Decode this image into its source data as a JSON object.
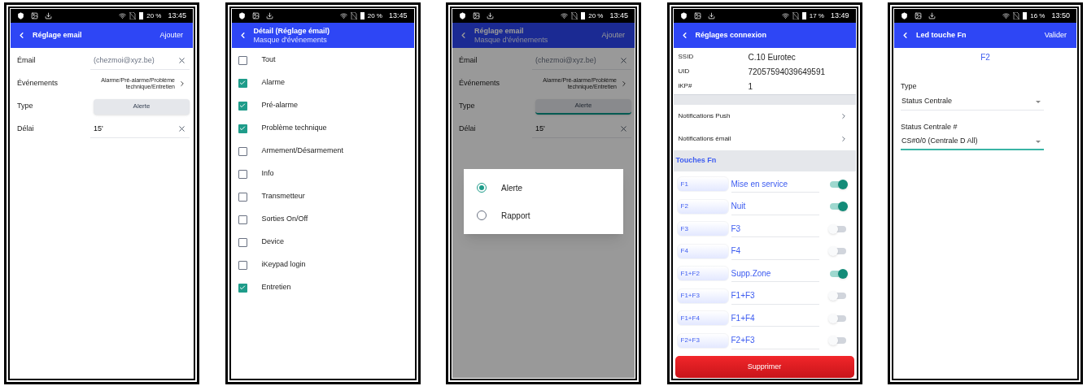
{
  "phones": [
    {
      "kind": "email_settings",
      "status_bar": {
        "battery": "20 %",
        "time": "13:45"
      },
      "header": {
        "title": "Réglage email",
        "action": "Ajouter"
      },
      "fields": [
        {
          "kind": "text",
          "label": "Émail",
          "placeholder": "(chezmoi@xyz.be)"
        },
        {
          "kind": "link",
          "label": "Événements",
          "value": "Alarme/Pré-alarme/Problème technique/Entretien"
        },
        {
          "kind": "button",
          "label": "Type",
          "value": "Alerte",
          "focused": false
        },
        {
          "kind": "text",
          "label": "Délai",
          "value": "15'"
        }
      ]
    },
    {
      "kind": "event_mask",
      "status_bar": {
        "battery": "20 %",
        "time": "13:45"
      },
      "header": {
        "title": "Détail (Réglage émail)",
        "subtitle": "Masque d'événements"
      },
      "options": [
        {
          "label": "Tout",
          "checked": false
        },
        {
          "label": "Alarme",
          "checked": true
        },
        {
          "label": "Pré-alarme",
          "checked": true
        },
        {
          "label": "Problème technique",
          "checked": true
        },
        {
          "label": "Armement/Désarmement",
          "checked": false
        },
        {
          "label": "Info",
          "checked": false
        },
        {
          "label": "Transmetteur",
          "checked": false
        },
        {
          "label": "Sorties On/Off",
          "checked": false
        },
        {
          "label": "Device",
          "checked": false
        },
        {
          "label": "iKeypad login",
          "checked": false
        },
        {
          "label": "Entretien",
          "checked": true
        }
      ]
    },
    {
      "kind": "type_dialog",
      "status_bar": {
        "battery": "20 %",
        "time": "13:45"
      },
      "header": {
        "title": "Réglage email",
        "subtitle": "Masque d'événements",
        "action": "Ajouter"
      },
      "fields": [
        {
          "kind": "text",
          "label": "Émail",
          "placeholder": "(chezmoi@xyz.be)"
        },
        {
          "kind": "link",
          "label": "Événements",
          "value": "Alarme/Pré-alarme/Problème technique/Entretien"
        },
        {
          "kind": "button",
          "label": "Type",
          "value": "Alerte",
          "focused": true
        },
        {
          "kind": "text",
          "label": "Délai",
          "value": "15'"
        }
      ],
      "dialog": {
        "options": [
          {
            "label": "Alerte",
            "selected": true
          },
          {
            "label": "Rapport",
            "selected": false
          }
        ]
      }
    },
    {
      "kind": "connection_settings",
      "status_bar": {
        "battery": "17 %",
        "time": "13:49"
      },
      "header": {
        "title": "Réglages connexion"
      },
      "info": [
        {
          "label": "SSID",
          "value": "C.10 Eurotec"
        },
        {
          "label": "UID",
          "value": "72057594039649591"
        },
        {
          "label": "iKP#",
          "value": "1"
        }
      ],
      "links": [
        "Notifications Push",
        "Notifications émail"
      ],
      "section": "Touches Fn",
      "fn_keys": [
        {
          "key": "F1",
          "label": "Mise en service",
          "on": true
        },
        {
          "key": "F2",
          "label": "Nuit",
          "on": true
        },
        {
          "key": "F3",
          "label": "F3",
          "on": false
        },
        {
          "key": "F4",
          "label": "F4",
          "on": false
        },
        {
          "key": "F1+F2",
          "label": "Supp.Zone",
          "on": true
        },
        {
          "key": "F1+F3",
          "label": "F1+F3",
          "on": false
        },
        {
          "key": "F1+F4",
          "label": "F1+F4",
          "on": false
        },
        {
          "key": "F2+F3",
          "label": "F2+F3",
          "on": false
        }
      ],
      "delete_button": "Supprimer"
    },
    {
      "kind": "fn_led",
      "status_bar": {
        "battery": "16 %",
        "time": "13:50"
      },
      "header": {
        "title": "Led touche Fn",
        "action": "Valider"
      },
      "key": "F2",
      "selects": [
        {
          "label": "Type",
          "value": "Status Centrale",
          "focused": false
        },
        {
          "label": "Status Centrale #",
          "value": "CS#0/0 (Centrale D All)",
          "focused": true
        }
      ]
    }
  ]
}
